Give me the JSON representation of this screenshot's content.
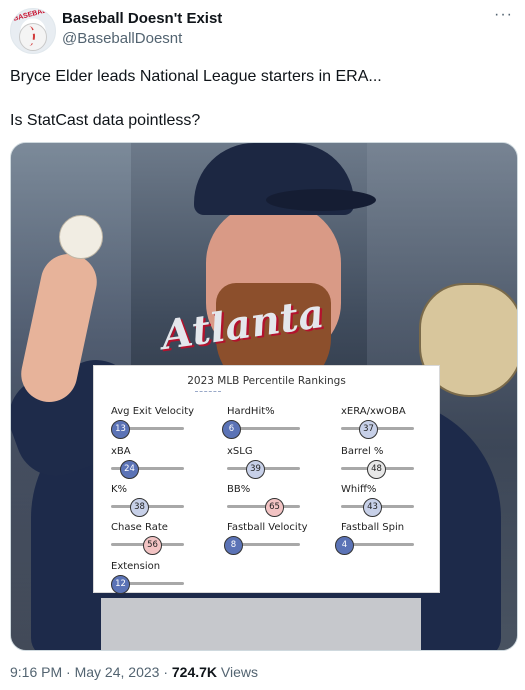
{
  "tweet": {
    "author_name": "Baseball Doesn't Exist",
    "author_handle": "@BaseballDoesnt",
    "more_icon": "···",
    "text_line1": "Bryce Elder leads National League starters in ERA...",
    "text_line2": "Is StatCast data pointless?",
    "time": "9:16 PM",
    "sep1": " · ",
    "date": "May 24, 2023",
    "sep2": " · ",
    "views_count": "724.7K",
    "views_label": " Views"
  },
  "photo": {
    "jersey_text": "Atlanta"
  },
  "card": {
    "title": "2023 MLB Percentile Rankings",
    "colors": {
      "low": "#5b73b6",
      "mid_low": "#c7d0e8",
      "mid": "#e7e7e7",
      "mid_high": "#f2c3c3",
      "high": "#e8898a"
    },
    "metrics": [
      {
        "label": "Avg Exit Velocity",
        "value": 13
      },
      {
        "label": "HardHit%",
        "value": 6
      },
      {
        "label": "xERA/xwOBA",
        "value": 37
      },
      {
        "label": "xBA",
        "value": 24
      },
      {
        "label": "xSLG",
        "value": 39
      },
      {
        "label": "Barrel %",
        "value": 48
      },
      {
        "label": "K%",
        "value": 38
      },
      {
        "label": "BB%",
        "value": 65
      },
      {
        "label": "Whiff%",
        "value": 43
      },
      {
        "label": "Chase Rate",
        "value": 56
      },
      {
        "label": "Fastball Velocity",
        "value": 8
      },
      {
        "label": "Fastball Spin",
        "value": 4
      },
      {
        "label": "Extension",
        "value": 12
      }
    ]
  }
}
